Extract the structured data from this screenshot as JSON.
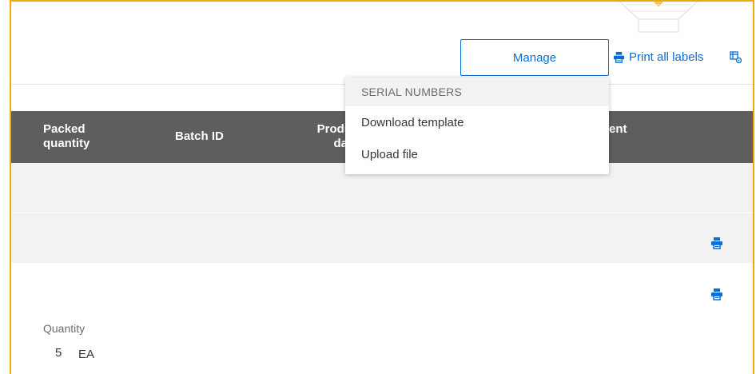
{
  "toolbar": {
    "manage_label": "Manage",
    "print_all_label": "Print all labels"
  },
  "table": {
    "columns": [
      {
        "label": "Packed\nquantity"
      },
      {
        "label": "Batch ID"
      },
      {
        "label": "Produ\ndat"
      },
      {
        "label": "ent"
      }
    ]
  },
  "dropdown": {
    "group_header": "SERIAL NUMBERS",
    "items": [
      {
        "label": "Download template"
      },
      {
        "label": "Upload file"
      }
    ]
  },
  "details": {
    "quantity_label": "Quantity",
    "quantity_value": "5",
    "quantity_unit": "EA"
  },
  "colors": {
    "accent": "#0a6ed1",
    "header_bg": "#5e5e5e",
    "frame": "#f0ab00"
  }
}
